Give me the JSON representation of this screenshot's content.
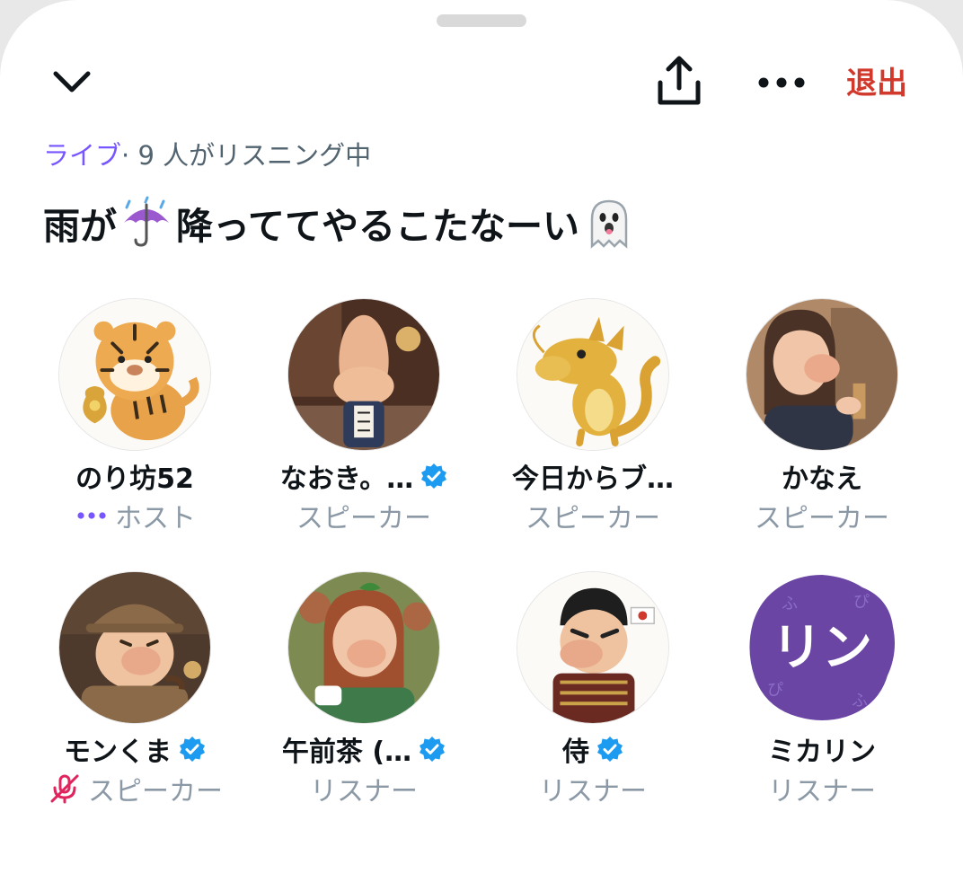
{
  "header": {
    "leave_label": "退出",
    "icons": [
      "chevron-down-icon",
      "share-icon",
      "more-icon"
    ]
  },
  "space": {
    "live_label": "ライブ",
    "listener_text": "· 9 人がリスニング中",
    "title_part1": "雨が",
    "title_part2": "降っててやるこたなーい",
    "title_emojis": [
      "umbrella-rain-emoji",
      "ghost-emoji"
    ]
  },
  "participants": [
    {
      "name": "のり坊52",
      "role": "ホスト",
      "verified": false,
      "role_icon": "speaking-dots-icon"
    },
    {
      "name": "なおき。…",
      "role": "スピーカー",
      "verified": true
    },
    {
      "name": "今日からブ…",
      "role": "スピーカー",
      "verified": false
    },
    {
      "name": "かなえ",
      "role": "スピーカー",
      "verified": false
    },
    {
      "name": "モンくま",
      "role": "スピーカー",
      "verified": true,
      "role_icon": "mic-muted-icon"
    },
    {
      "name": "午前茶 (…",
      "role": "リスナー",
      "verified": true
    },
    {
      "name": "侍",
      "role": "リスナー",
      "verified": true
    },
    {
      "name": "ミカリン",
      "role": "リスナー",
      "verified": false,
      "avatar_text": "リン"
    }
  ],
  "colors": {
    "live": "#7856ff",
    "leave": "#d0392b",
    "verified": "#1d9bf0",
    "muted": "#f4212e",
    "secondary_text": "#8b98a5"
  }
}
